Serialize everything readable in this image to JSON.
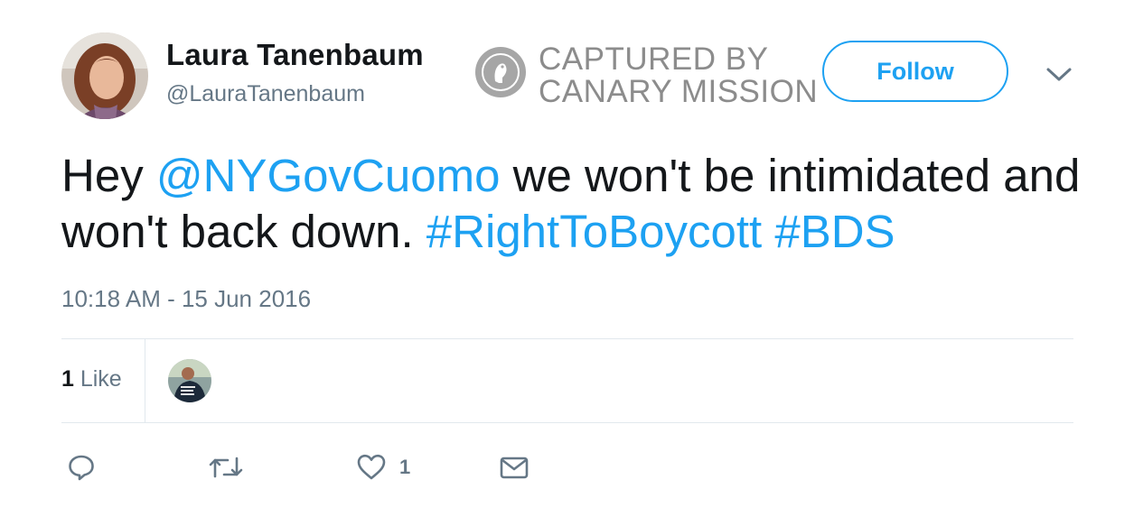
{
  "user": {
    "name": "Laura Tanenbaum",
    "handle": "@LauraTanenbaum"
  },
  "watermark": {
    "line1": "CAPTURED BY",
    "line2": "CANARY MISSION"
  },
  "follow_label": "Follow",
  "tweet": {
    "prefix": "Hey ",
    "mention": "@NYGovCuomo",
    "middle": " we won't be intimidated and won't back down. ",
    "hashtag1": "#RightToBoycott",
    "space": " ",
    "hashtag2": "#BDS",
    "timestamp": "10:18 AM - 15 Jun 2016"
  },
  "stats": {
    "likes_number": "1",
    "likes_label": " Like"
  },
  "actions": {
    "reply_icon": "reply-icon",
    "retweet_icon": "retweet-icon",
    "like_icon": "heart-icon",
    "like_count": "1",
    "dm_icon": "envelope-icon"
  },
  "colors": {
    "accent": "#1da1f2",
    "muted": "#657786",
    "text": "#14171a",
    "divider": "#e1e8ed"
  }
}
